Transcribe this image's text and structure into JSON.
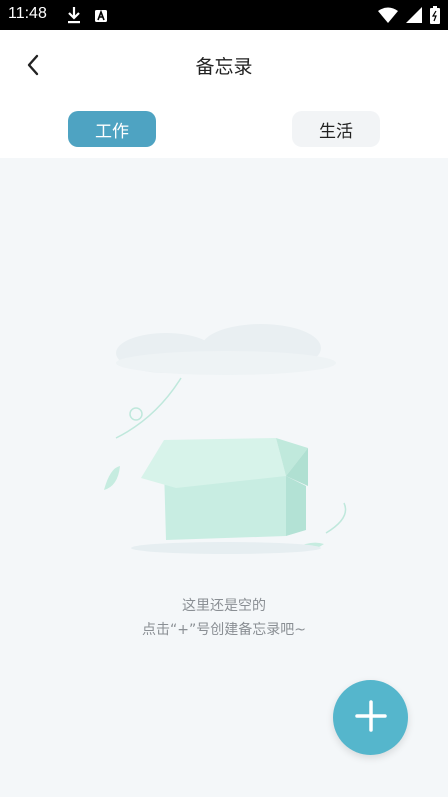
{
  "status_bar": {
    "time": "11:48"
  },
  "header": {
    "title": "备忘录"
  },
  "tabs": [
    {
      "label": "工作"
    },
    {
      "label": "生活"
    }
  ],
  "empty_state": {
    "line1": "这里还是空的",
    "line2": "点击“+”号创建备忘录吧~"
  },
  "colors": {
    "accent": "#4ea3c2",
    "fab": "#55b6cc",
    "background": "#f4f7f9"
  },
  "icons": {
    "back": "chevron-left-icon",
    "add": "plus-icon"
  }
}
